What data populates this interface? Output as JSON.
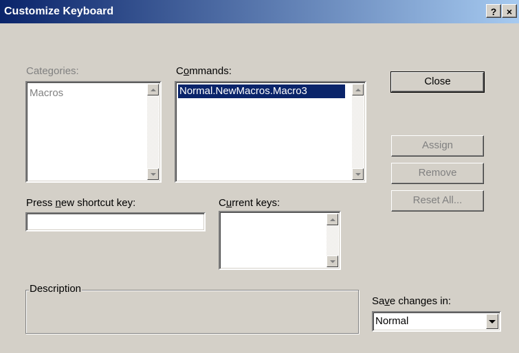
{
  "window": {
    "title": "Customize Keyboard",
    "help_label": "?",
    "close_label": "×"
  },
  "categories": {
    "label": "Categories:",
    "items": [
      "Macros"
    ]
  },
  "commands": {
    "label_before": "C",
    "label_accel": "o",
    "label_after": "mmands:",
    "items": [
      "Normal.NewMacros.Macro3"
    ]
  },
  "shortcut": {
    "label_before": "Press ",
    "label_accel": "n",
    "label_after": "ew shortcut key:",
    "value": ""
  },
  "current_keys": {
    "label_before": "C",
    "label_accel": "u",
    "label_after": "rrent keys:"
  },
  "description": {
    "label": "Description"
  },
  "save_in": {
    "label_before": "Sa",
    "label_accel": "v",
    "label_after": "e changes in:",
    "value": "Normal"
  },
  "buttons": {
    "close": "Close",
    "assign": "Assign",
    "remove": "Remove",
    "reset_all": "Reset All..."
  }
}
